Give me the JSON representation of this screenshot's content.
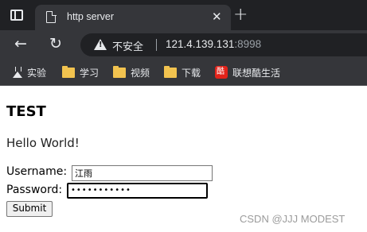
{
  "tab": {
    "title": "http server",
    "close": "✕",
    "new_tab": "+"
  },
  "toolbar": {
    "back": "←",
    "reload": "↻"
  },
  "omnibox": {
    "security_label": "不安全",
    "url_host": "121.4.139.131",
    "url_port": ":8998"
  },
  "bookmarks": [
    {
      "label": "实验",
      "icon": "flask-icon"
    },
    {
      "label": "学习",
      "icon": "folder-icon"
    },
    {
      "label": "视频",
      "icon": "folder-icon"
    },
    {
      "label": "下载",
      "icon": "folder-icon"
    },
    {
      "label": "联想酷生活",
      "icon": "lenovo-icon"
    }
  ],
  "page": {
    "heading": "TEST",
    "greeting": "Hello World!",
    "username_label": "Username:",
    "username_value": "江雨",
    "password_label": "Password:",
    "password_value": "•••••••••••",
    "submit_label": "Submit"
  },
  "watermark": "CSDN @JJJ MODEST",
  "colors": {
    "tabstrip": "#202124",
    "toolbar": "#35363a",
    "folder": "#f2c34f",
    "lenovo": "#e2231a"
  }
}
